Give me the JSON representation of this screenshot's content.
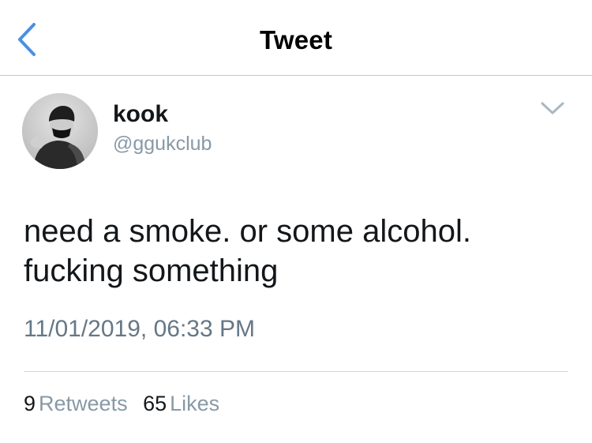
{
  "nav": {
    "title": "Tweet",
    "back_icon": "chevron-left-icon",
    "accent_color": "#4a90e2"
  },
  "tweet": {
    "display_name": "kook",
    "handle": "@ggukclub",
    "text_lines": [
      "need a smoke. or some alcohol.",
      "fucking something"
    ],
    "timestamp": "11/01/2019, 06:33 PM",
    "more_icon": "chevron-down-icon",
    "stats": {
      "retweets_count": "9",
      "retweets_label": "Retweets",
      "likes_count": "65",
      "likes_label": "Likes"
    }
  },
  "colors": {
    "text_primary": "#14171a",
    "text_secondary": "#8899a6",
    "divider": "#ccd6dd"
  }
}
